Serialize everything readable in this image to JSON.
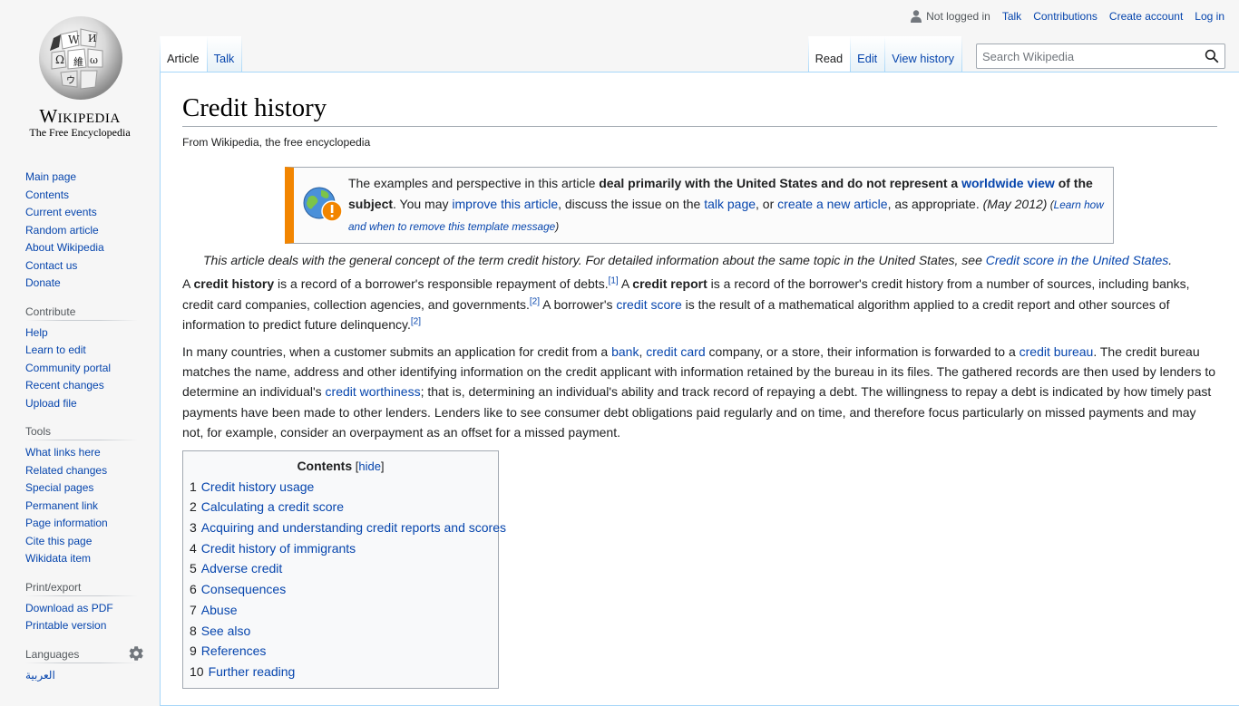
{
  "logo": {
    "wordmark": "Wikipedia",
    "tagline": "The Free Encyclopedia"
  },
  "personal": {
    "not_logged_in": "Not logged in",
    "talk": "Talk",
    "contributions": "Contributions",
    "create_account": "Create account",
    "login": "Log in"
  },
  "tabs": {
    "article": "Article",
    "talk": "Talk",
    "read": "Read",
    "edit": "Edit",
    "view_history": "View history"
  },
  "search": {
    "placeholder": "Search Wikipedia"
  },
  "sidebar": {
    "navigation": [
      "Main page",
      "Contents",
      "Current events",
      "Random article",
      "About Wikipedia",
      "Contact us",
      "Donate"
    ],
    "contribute_heading": "Contribute",
    "contribute": [
      "Help",
      "Learn to edit",
      "Community portal",
      "Recent changes",
      "Upload file"
    ],
    "tools_heading": "Tools",
    "tools": [
      "What links here",
      "Related changes",
      "Special pages",
      "Permanent link",
      "Page information",
      "Cite this page",
      "Wikidata item"
    ],
    "print_heading": "Print/export",
    "print": [
      "Download as PDF",
      "Printable version"
    ],
    "languages_heading": "Languages",
    "languages": [
      "العربية"
    ]
  },
  "article": {
    "title": "Credit history",
    "sitesub": "From Wikipedia, the free encyclopedia",
    "ambox": {
      "t1": "The examples and perspective in this article ",
      "b1": "deal primarily with the United States and do not represent a ",
      "link_worldwide": "worldwide view",
      "b2": " of the subject",
      "t2": ". You may ",
      "link_improve": "improve this article",
      "t3": ", discuss the issue on the ",
      "link_talk": "talk page",
      "t4": ", or ",
      "link_create": "create a new article",
      "t5": ", as appropriate. ",
      "date": "(May 2012)",
      "paren_open": " (",
      "link_learn": "Learn how and when to remove this template message",
      "paren_close": ")"
    },
    "hatnote": {
      "text": "This article deals with the general concept of the term credit history. For detailed information about the same topic in the United States, see ",
      "link": "Credit score in the United States",
      "end": "."
    },
    "p1": {
      "a": "A ",
      "b_credit_history": "credit history",
      "c": " is a record of a borrower's responsible repayment of debts.",
      "ref1": "[1]",
      "d": " A ",
      "b_credit_report": "credit report",
      "e": " is a record of the borrower's credit history from a number of sources, including banks, credit card companies, collection agencies, and governments.",
      "ref2": "[2]",
      "f": " A borrower's ",
      "link_credit_score": "credit score",
      "g": " is the result of a mathematical algorithm applied to a credit report and other sources of information to predict future delinquency.",
      "ref3": "[2]"
    },
    "p2": {
      "a": "In many countries, when a customer submits an application for credit from a ",
      "link_bank": "bank",
      "b": ", ",
      "link_credit_card": "credit card",
      "c": " company, or a store, their information is forwarded to a ",
      "link_credit_bureau": "credit bureau",
      "d": ". The credit bureau matches the name, address and other identifying information on the credit applicant with information retained by the bureau in its files. The gathered records are then used by lenders to determine an individual's ",
      "link_worthiness": "credit worthiness",
      "e": "; that is, determining an individual's ability and track record of repaying a debt. The willingness to repay a debt is indicated by how timely past payments have been made to other lenders. Lenders like to see consumer debt obligations paid regularly and on time, and therefore focus particularly on missed payments and may not, for example, consider an overpayment as an offset for a missed payment."
    },
    "toc": {
      "title": "Contents",
      "hide_open": " [",
      "hide": "hide",
      "hide_close": "]",
      "items": [
        {
          "num": "1",
          "label": "Credit history usage"
        },
        {
          "num": "2",
          "label": "Calculating a credit score"
        },
        {
          "num": "3",
          "label": "Acquiring and understanding credit reports and scores"
        },
        {
          "num": "4",
          "label": "Credit history of immigrants"
        },
        {
          "num": "5",
          "label": "Adverse credit"
        },
        {
          "num": "6",
          "label": "Consequences"
        },
        {
          "num": "7",
          "label": "Abuse"
        },
        {
          "num": "8",
          "label": "See also"
        },
        {
          "num": "9",
          "label": "References"
        },
        {
          "num": "10",
          "label": "Further reading"
        }
      ]
    }
  }
}
